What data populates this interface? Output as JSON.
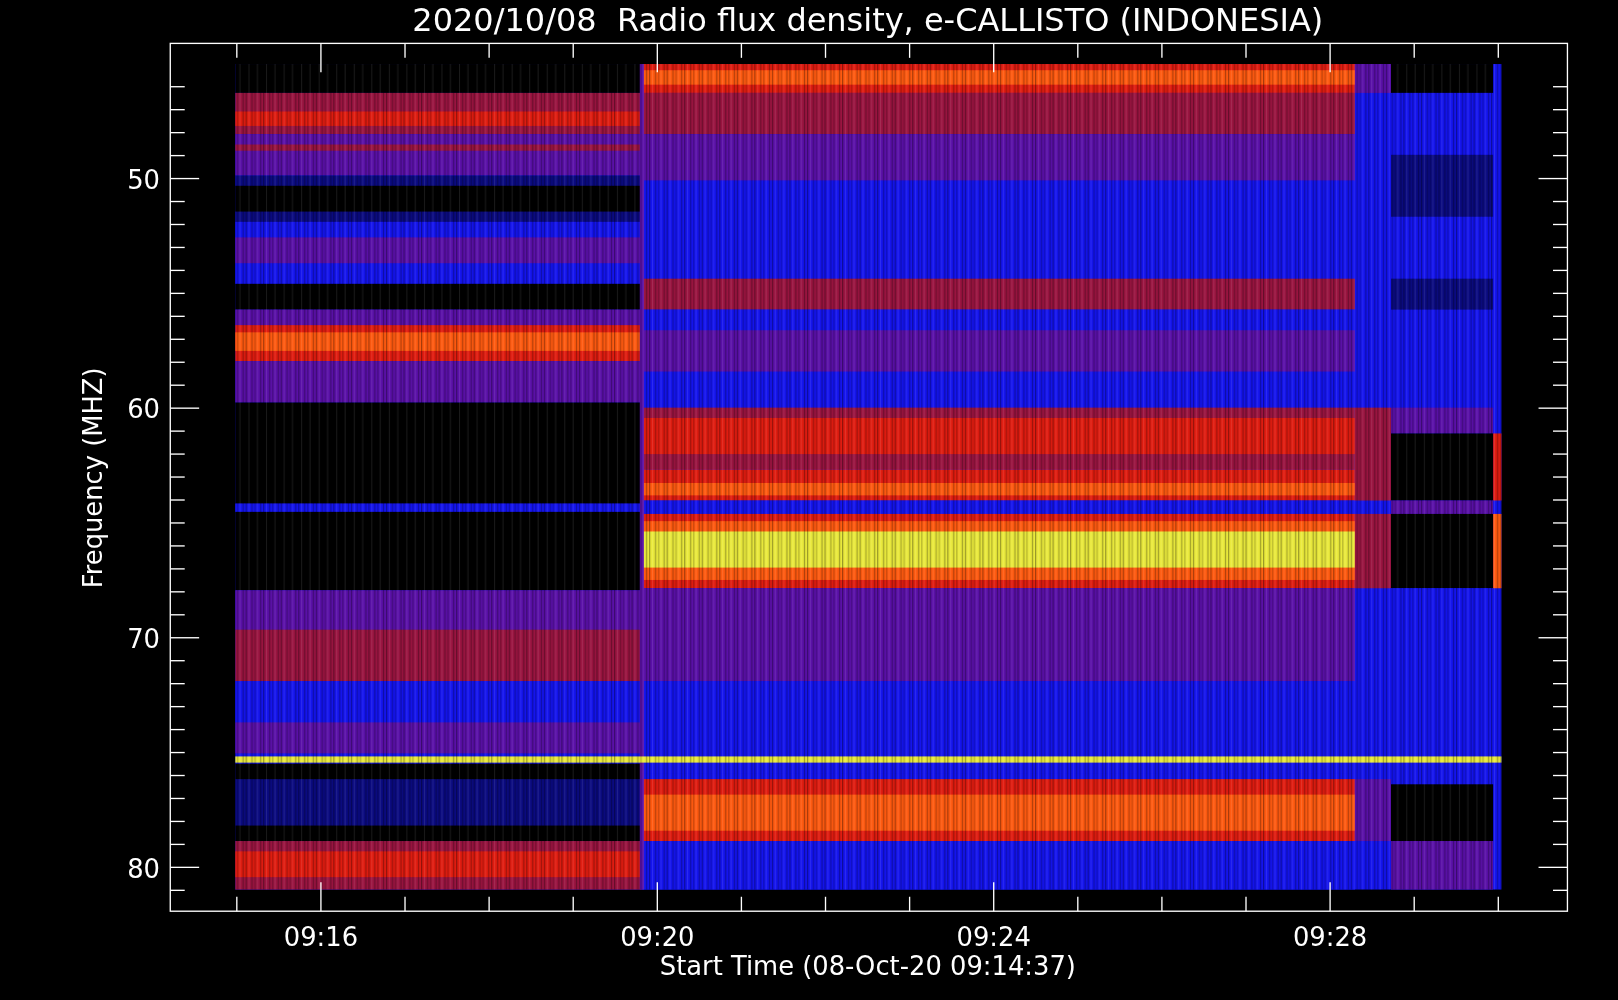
{
  "title": "2020/10/08  Radio flux density, e-CALLISTO (INDONESIA)",
  "y_axis": {
    "label": "Frequency (MHZ)",
    "ticks": [
      "50",
      "60",
      "70",
      "80"
    ]
  },
  "x_axis": {
    "label": "Start Time (08-Oct-20 09:14:37)",
    "ticks": [
      "09:16",
      "09:20",
      "09:24",
      "09:28"
    ]
  }
}
